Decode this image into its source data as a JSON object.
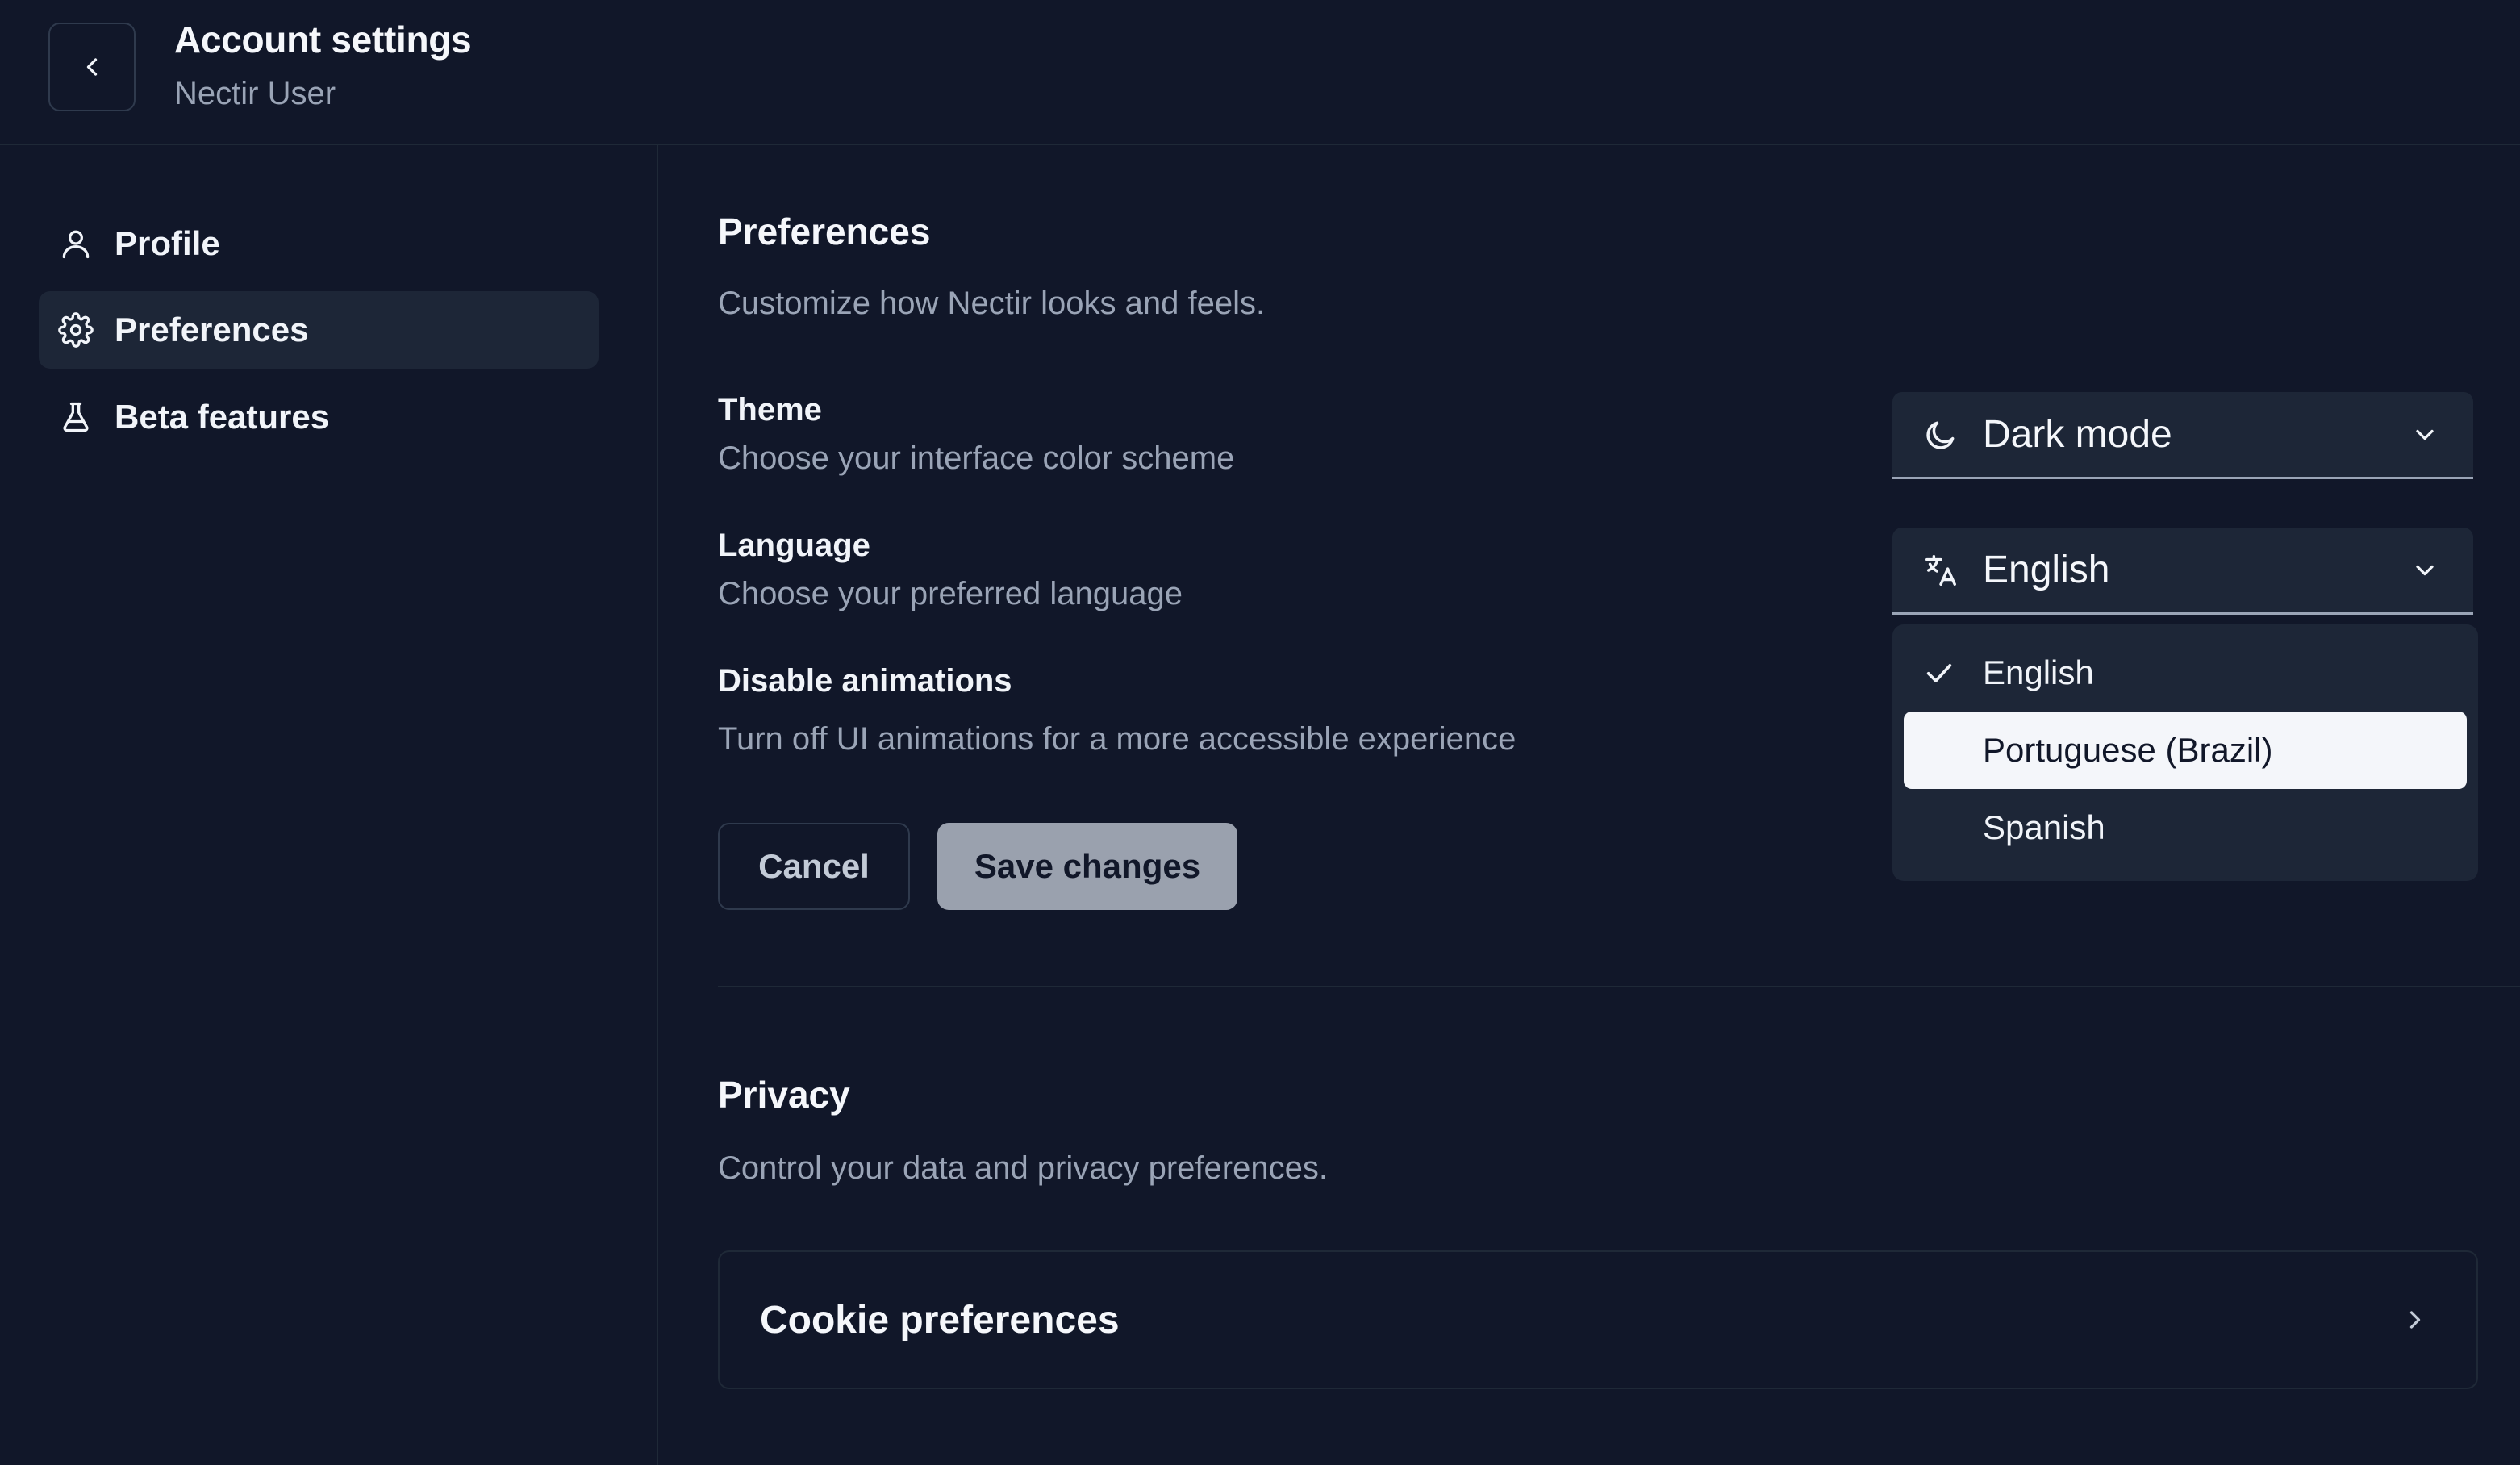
{
  "header": {
    "title": "Account settings",
    "subtitle": "Nectir User",
    "back_icon": "chevron-left-icon"
  },
  "sidebar": {
    "items": [
      {
        "label": "Profile",
        "icon": "user-icon",
        "active": false
      },
      {
        "label": "Preferences",
        "icon": "gear-icon",
        "active": true
      },
      {
        "label": "Beta features",
        "icon": "flask-icon",
        "active": false
      }
    ]
  },
  "preferences": {
    "title": "Preferences",
    "description": "Customize how Nectir looks and feels.",
    "theme": {
      "label": "Theme",
      "description": "Choose your interface color scheme",
      "value": "Dark mode",
      "icon": "moon-icon"
    },
    "language": {
      "label": "Language",
      "description": "Choose your preferred language",
      "value": "English",
      "icon": "translate-icon",
      "options": [
        {
          "label": "English",
          "selected": true,
          "highlighted": false
        },
        {
          "label": "Portuguese (Brazil)",
          "selected": false,
          "highlighted": true
        },
        {
          "label": "Spanish",
          "selected": false,
          "highlighted": false
        }
      ]
    },
    "animations": {
      "label": "Disable animations",
      "description": "Turn off UI animations for a more accessible experience"
    },
    "cancel_label": "Cancel",
    "save_label": "Save changes"
  },
  "privacy": {
    "title": "Privacy",
    "description": "Control your data and privacy preferences.",
    "cookie_label": "Cookie preferences"
  },
  "colors": {
    "background": "#111729",
    "surface": "#1d2637",
    "border": "#1f2937",
    "muted_text": "#9aa4b6",
    "save_button": "#9aa1ae"
  }
}
